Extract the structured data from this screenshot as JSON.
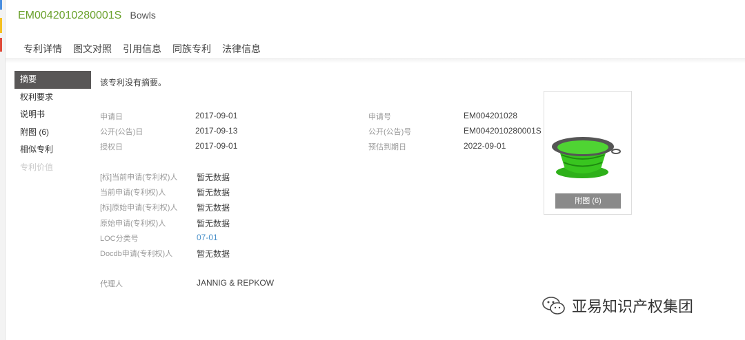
{
  "header": {
    "patent_number": "EM0042010280001S",
    "title": "Bowls"
  },
  "tabs": [
    "专利详情",
    "图文对照",
    "引用信息",
    "同族专利",
    "法律信息"
  ],
  "sidebar": [
    {
      "label": "摘要",
      "state": "active"
    },
    {
      "label": "权利要求"
    },
    {
      "label": "说明书"
    },
    {
      "label": "附图 (6)"
    },
    {
      "label": "相似专利"
    },
    {
      "label": "专利价值",
      "state": "disabled"
    }
  ],
  "abstract": "该专利没有摘要。",
  "left_fields": [
    {
      "label": "申请日",
      "value": "2017-09-01"
    },
    {
      "label": "公开(公告)日",
      "value": "2017-09-13"
    },
    {
      "label": "授权日",
      "value": "2017-09-01"
    }
  ],
  "right_fields": [
    {
      "label": "申请号",
      "value": "EM004201028"
    },
    {
      "label": "公开(公告)号",
      "value": "EM0042010280001S"
    },
    {
      "label": "预估到期日",
      "value": "2022-09-01"
    }
  ],
  "party_fields": [
    {
      "label": "[标]当前申请(专利权)人",
      "value": "暂无数据"
    },
    {
      "label": "当前申请(专利权)人",
      "value": "暂无数据"
    },
    {
      "label": "[标]原始申请(专利权)人",
      "value": "暂无数据"
    },
    {
      "label": "原始申请(专利权)人",
      "value": "暂无数据"
    },
    {
      "label": "LOC分类号",
      "value": "07-01"
    },
    {
      "label": "Docdb申请(专利权)人",
      "value": "暂无数据"
    }
  ],
  "agent": {
    "label": "代理人",
    "value": "JANNIG & REPKOW"
  },
  "image_panel": {
    "button": "附图 (6)"
  },
  "watermark": "亚易知识产权集团"
}
